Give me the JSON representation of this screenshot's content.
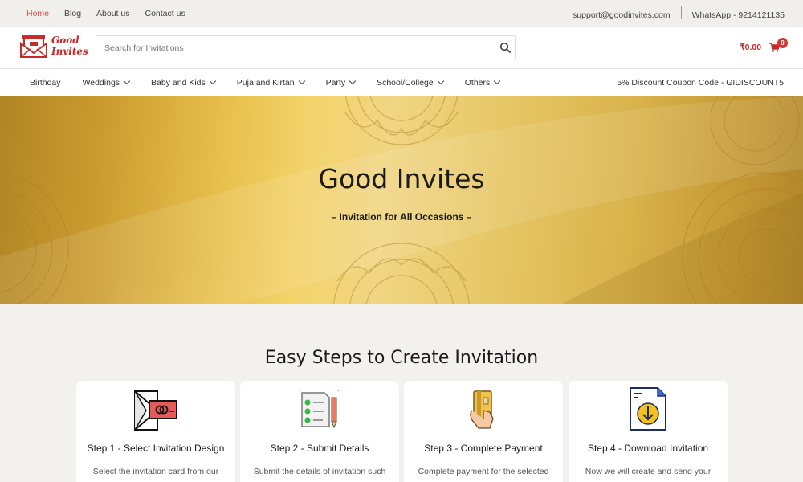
{
  "topbar": {
    "links": [
      "Home",
      "Blog",
      "About us",
      "Contact us"
    ],
    "email": "support@goodinvites.com",
    "whatsapp": "WhatsApp - 9214121135"
  },
  "header": {
    "logo_line1": "Good",
    "logo_line2": "Invites",
    "search_placeholder": "Search for Invitations",
    "cart_total": "₹0.00",
    "cart_count": "0"
  },
  "nav": {
    "items": [
      {
        "label": "Birthday",
        "dropdown": false
      },
      {
        "label": "Weddings",
        "dropdown": true
      },
      {
        "label": "Baby and Kids",
        "dropdown": true
      },
      {
        "label": "Puja and Kirtan",
        "dropdown": true
      },
      {
        "label": "Party",
        "dropdown": true
      },
      {
        "label": "School/College",
        "dropdown": true
      },
      {
        "label": "Others",
        "dropdown": true
      }
    ],
    "coupon": "5% Discount Coupon Code - GIDISCOUNT5"
  },
  "hero": {
    "title": "Good Invites",
    "subtitle": "– Invitation for All Occasions –"
  },
  "steps": {
    "heading": "Easy Steps to Create Invitation",
    "cards": [
      {
        "title": "Step 1 - Select Invitation Design",
        "desc": "Select the invitation card from our",
        "icon": "envelope-rings-icon"
      },
      {
        "title": "Step 2 - Submit Details",
        "desc": "Submit the details of invitation such",
        "icon": "checklist-pencil-icon"
      },
      {
        "title": "Step 3 - Complete Payment",
        "desc": "Complete payment for the selected",
        "icon": "card-payment-icon"
      },
      {
        "title": "Step 4 - Download Invitation",
        "desc": "Now we will create and send your",
        "icon": "download-file-icon"
      }
    ]
  },
  "colors": {
    "brand_red": "#c62a2a",
    "gold": "#e8c04c"
  }
}
